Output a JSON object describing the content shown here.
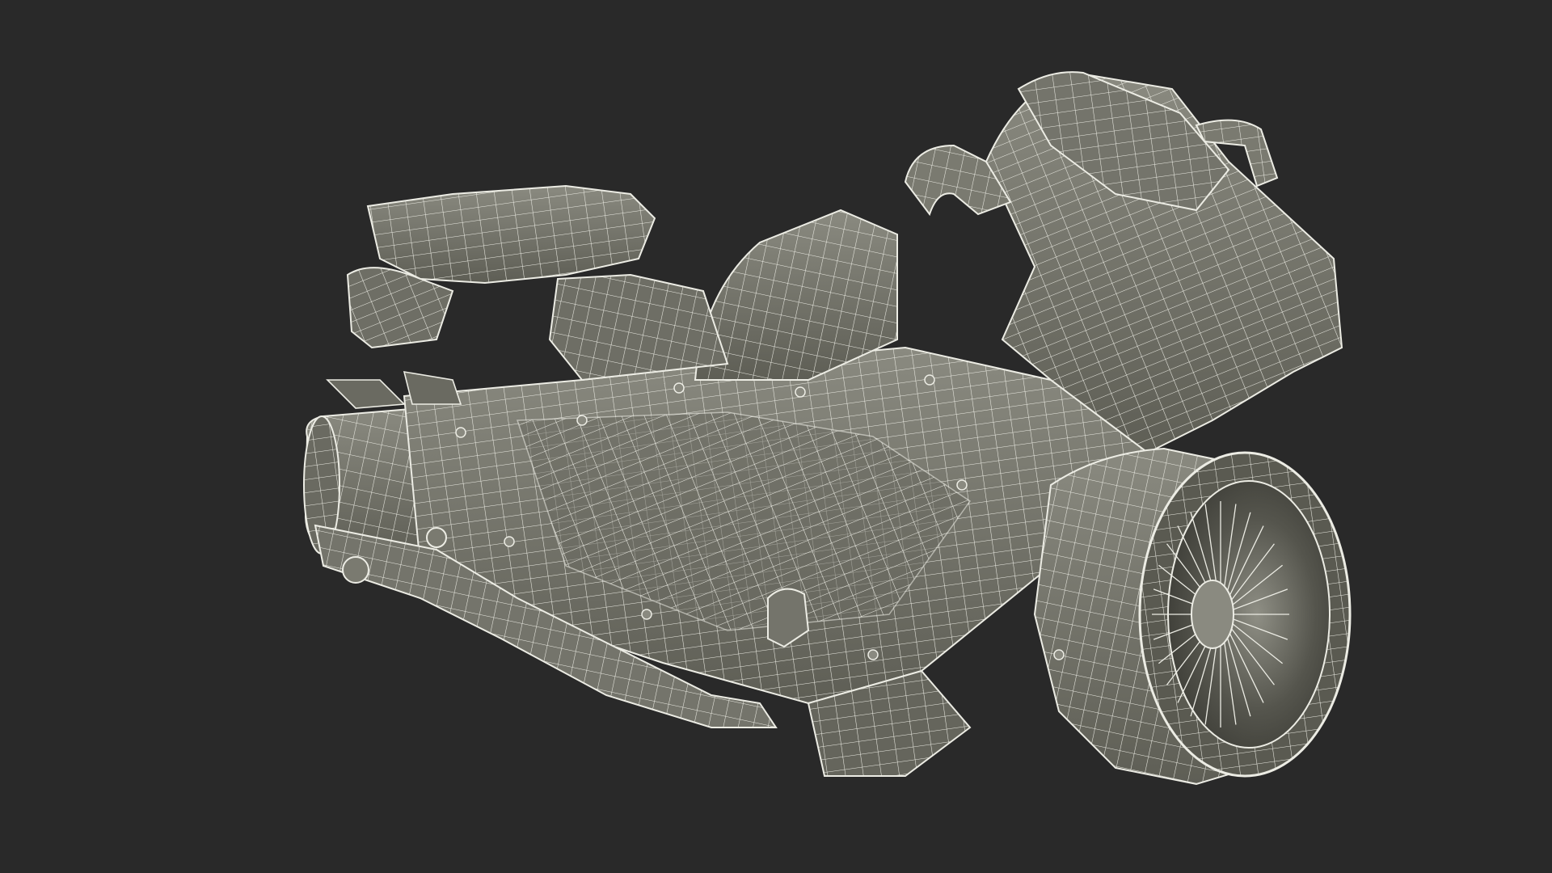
{
  "scene": {
    "background_color": "#292929",
    "model_fill_color": "#7d7d72",
    "model_shadow_color": "#56564d",
    "wire_color": "#ecece4"
  },
  "model": {
    "render_style": "wireframe-on-shaded"
  }
}
